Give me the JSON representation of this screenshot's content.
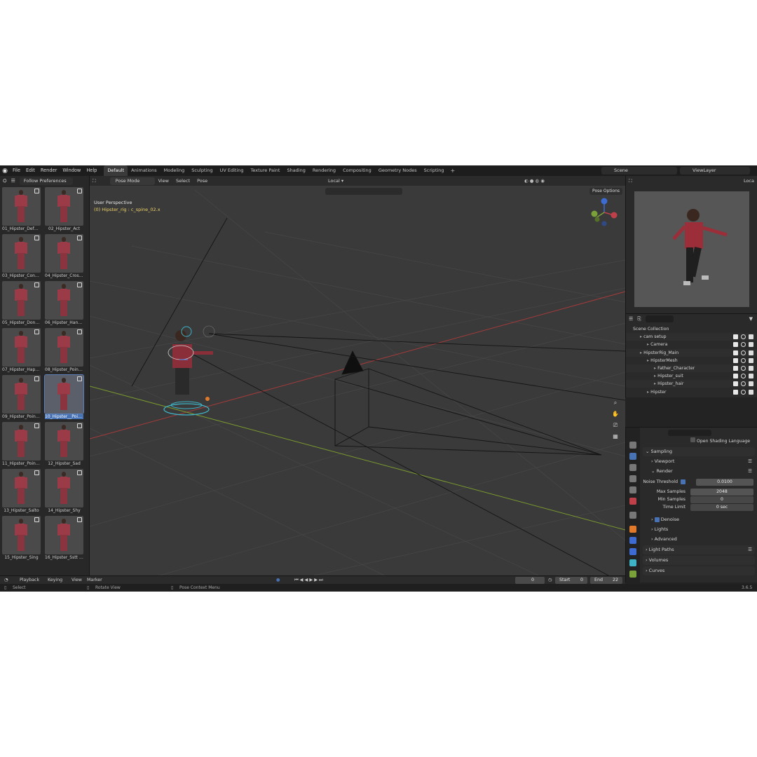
{
  "menu": {
    "items": [
      "File",
      "Edit",
      "Render",
      "Window",
      "Help"
    ]
  },
  "workspaces": [
    "Default",
    "Animations",
    "Modeling",
    "Sculpting",
    "UV Editing",
    "Texture Paint",
    "Shading",
    "Rendering",
    "Compositing",
    "Geometry Nodes",
    "Scripting"
  ],
  "active_workspace": "Default",
  "scene": "Scene",
  "view_layer": "ViewLayer",
  "asset_browser": {
    "library": "Follow Preferences",
    "assets": [
      "01_Hipster_Default",
      "02_Hipster_Act",
      "03_Hipster_Confu...",
      "04_Hipster_Cross...",
      "05_Hipster_Dont ...",
      "06_Hipster_Hand...",
      "07_Hipster_Happ...",
      "08_Hipster_Pointi...",
      "09_Hipster_Pointi...",
      "10_Hipster__Point...",
      "11_Hipster_Pointi...",
      "12_Hipster_Sad",
      "13_Hipster_Salto",
      "14_Hipster_Shy",
      "15_Hipster_Sing",
      "16_Hipster_Sstt 01"
    ],
    "selected_index": 9
  },
  "viewport": {
    "mode": "Pose Mode",
    "menus": [
      "View",
      "Select",
      "Pose"
    ],
    "orientation": "Local",
    "view_name": "User Perspective",
    "active_bone": "(0) Hipster_rig : c_spine_02.x",
    "pose_options": "Pose Options",
    "right_local": "Loca"
  },
  "outliner": {
    "rows": [
      {
        "label": "Scene Collection",
        "indent": 0
      },
      {
        "label": "cam setup",
        "indent": 1
      },
      {
        "label": "Camera",
        "indent": 2
      },
      {
        "label": "HipsterRig_Main",
        "indent": 1
      },
      {
        "label": "HipsterMesh",
        "indent": 2
      },
      {
        "label": "Father_Character",
        "indent": 3
      },
      {
        "label": "Hipster_suit",
        "indent": 3
      },
      {
        "label": "Hipster_hair",
        "indent": 3
      },
      {
        "label": "Hipster",
        "indent": 2
      }
    ]
  },
  "properties": {
    "open_shading_language": "Open Shading Language",
    "sampling": "Sampling",
    "viewport": "Viewport",
    "render": "Render",
    "noise_threshold_label": "Noise Threshold",
    "noise_threshold": "0.0100",
    "max_samples_label": "Max Samples",
    "max_samples": "2048",
    "min_samples_label": "Min Samples",
    "min_samples": "0",
    "time_limit_label": "Time Limit",
    "time_limit": "0 sec",
    "denoise": "Denoise",
    "lights": "Lights",
    "advanced": "Advanced",
    "light_paths": "Light Paths",
    "volumes": "Volumes",
    "curves": "Curves"
  },
  "timeline": {
    "menus": [
      "Playback",
      "Keying",
      "View",
      "Marker"
    ],
    "current_frame": "0",
    "start_label": "Start",
    "start": "0",
    "end_label": "End",
    "end": "22"
  },
  "statusbar": {
    "select": "Select",
    "rotate": "Rotate View",
    "context": "Pose Context Menu",
    "version": "3.6.5"
  },
  "colors": {
    "accent": "#4772b3",
    "x_axis": "#a53b3b",
    "y_axis": "#7a9a2e",
    "bone_active": "#f0d46a"
  }
}
